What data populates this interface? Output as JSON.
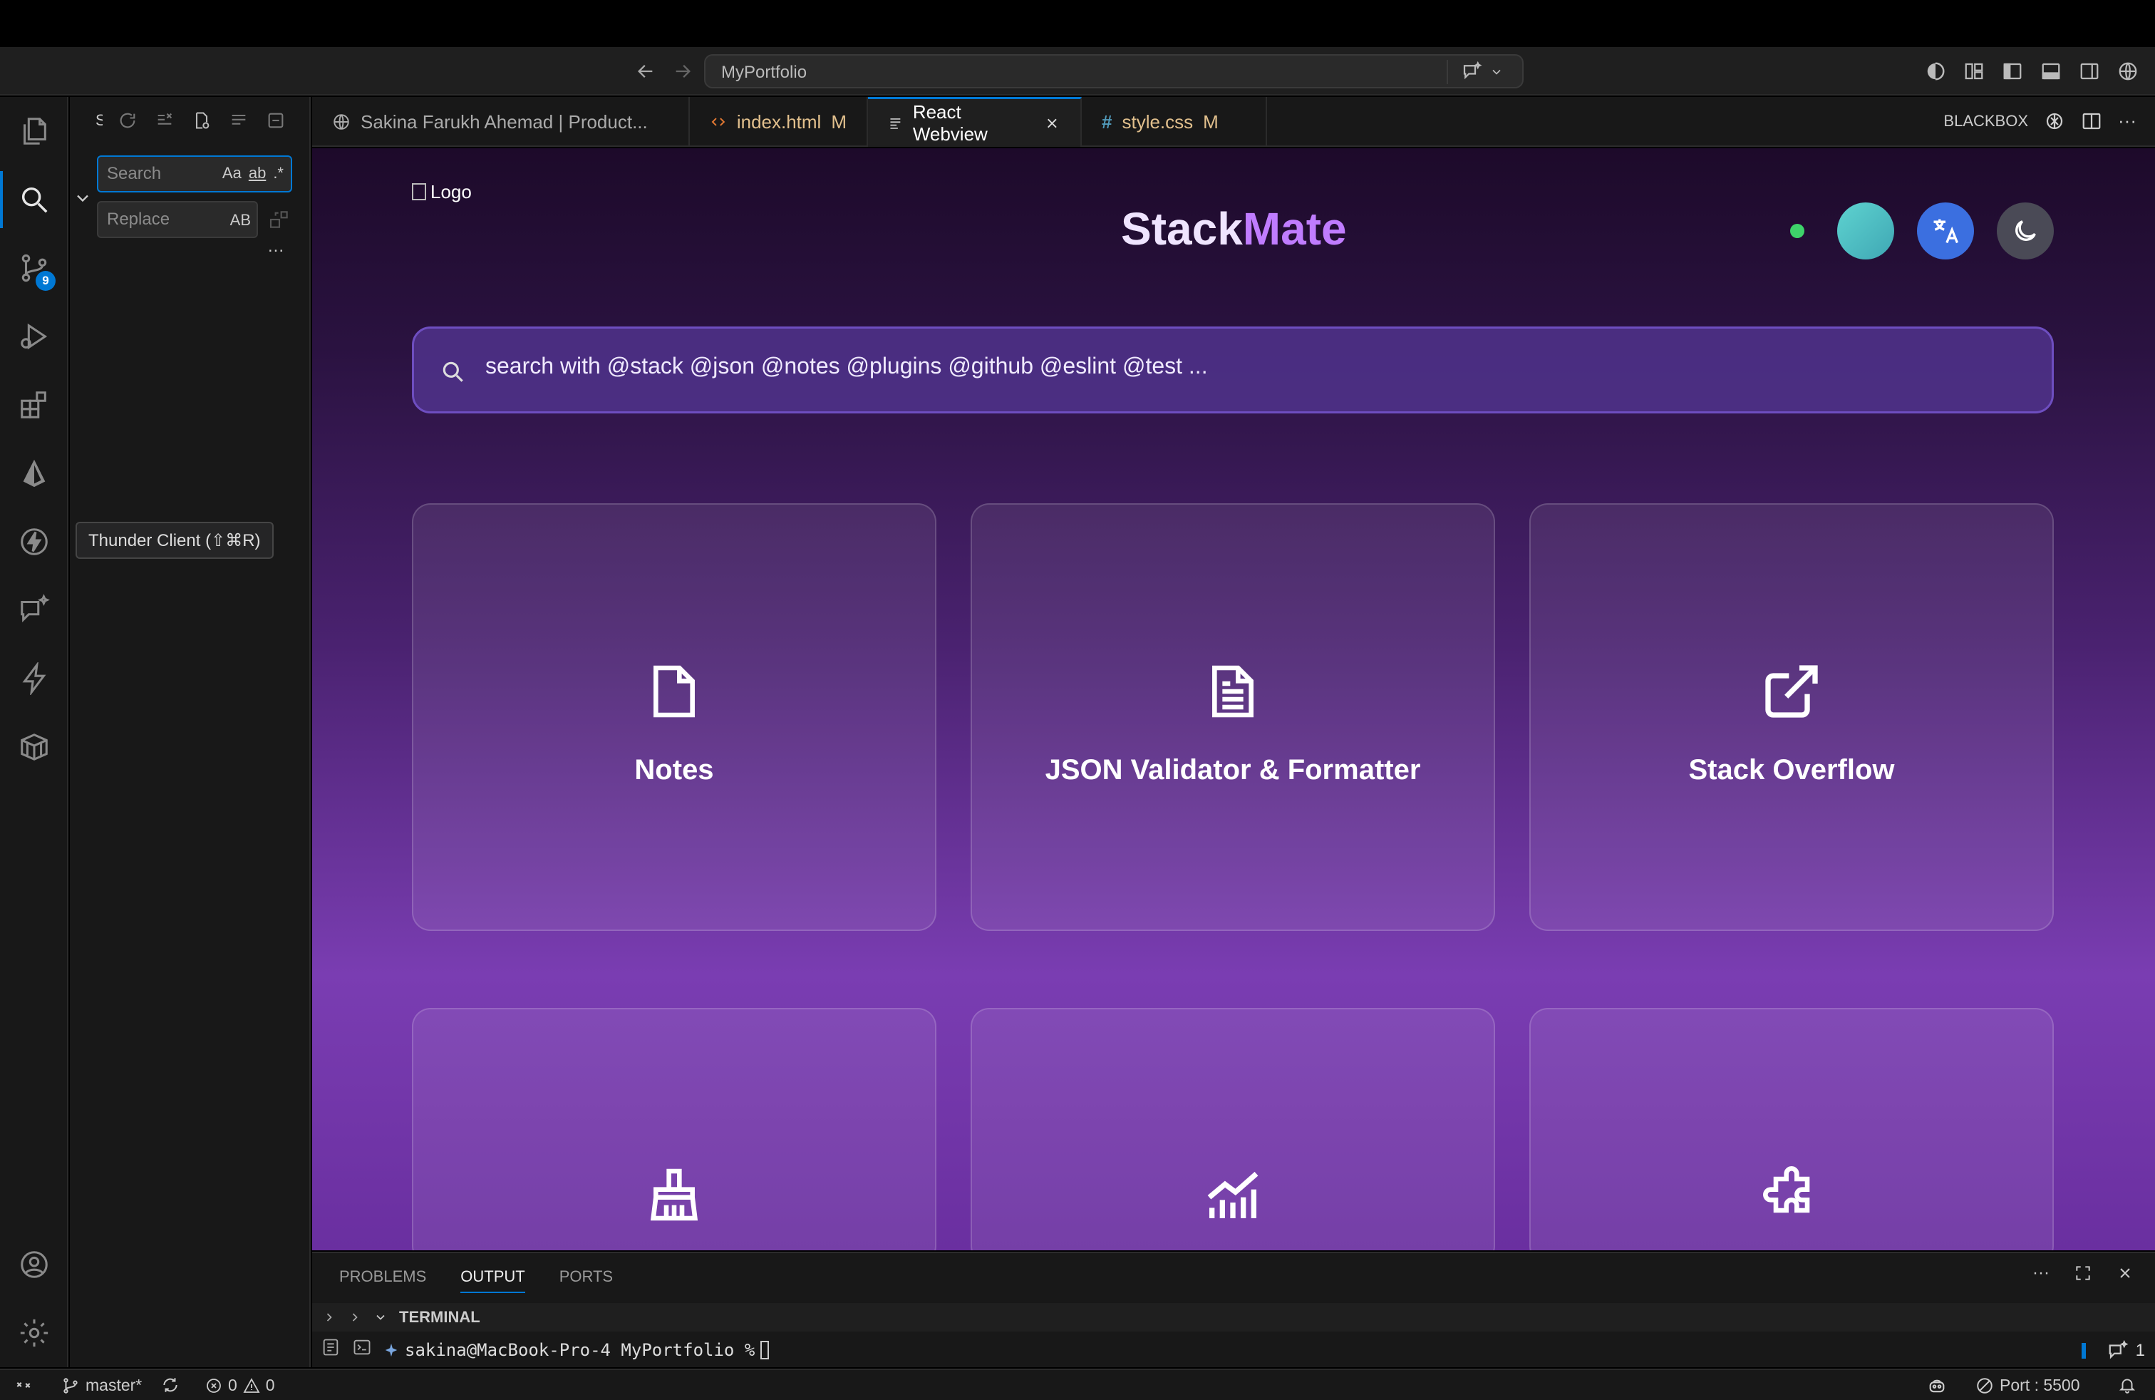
{
  "titlebar": {
    "workspace": "MyPortfolio"
  },
  "activity": {
    "source_control_badge": "9"
  },
  "sidebar": {
    "title_truncated": "S",
    "search_placeholder": "Search",
    "replace_placeholder": "Replace",
    "opt_case": "Aa",
    "opt_word": "ab",
    "opt_regex": ".*",
    "opt_preserve": "AB",
    "more": "..."
  },
  "tooltip": {
    "text": "Thunder Client (⇧⌘R)"
  },
  "tabs": [
    {
      "label": "Sakina Farukh Ahemad | Product...",
      "mod": ""
    },
    {
      "label": "index.html",
      "mod": "M"
    },
    {
      "label": "React Webview",
      "mod": ""
    },
    {
      "label": "style.css",
      "mod": "M"
    }
  ],
  "tab_right": {
    "blackbox": "BLACKBOX"
  },
  "webview": {
    "logo_alt": "Logo",
    "brand_part1": "Stack",
    "brand_part2": "Mate",
    "search_placeholder": "search with @stack @json @notes @plugins @github @eslint @test ...",
    "cards": [
      {
        "title": "Notes",
        "icon": "file-icon"
      },
      {
        "title": "JSON Validator & Formatter",
        "icon": "file-text-icon"
      },
      {
        "title": "Stack Overflow",
        "icon": "external-link-icon"
      },
      {
        "title": "",
        "icon": "broom-icon"
      },
      {
        "title": "",
        "icon": "chart-icon"
      },
      {
        "title": "",
        "icon": "puzzle-icon"
      }
    ]
  },
  "panel": {
    "tabs": [
      "PROBLEMS",
      "OUTPUT",
      "PORTS"
    ],
    "terminal_label": "TERMINAL",
    "prompt": "sakina@MacBook-Pro-4 MyPortfolio %",
    "terminal_count": "1"
  },
  "statusbar": {
    "branch": "master*",
    "errors": "0",
    "warnings": "0",
    "port": "Port : 5500"
  },
  "colors": {
    "accent": "#0078d4",
    "brand_light": "#efe4ff",
    "brand_purple": "#c07cff"
  }
}
